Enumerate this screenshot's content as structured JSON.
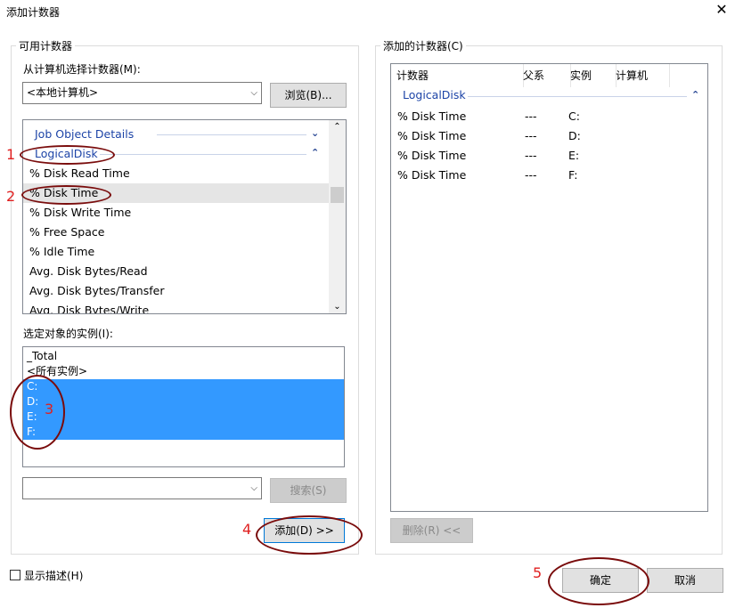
{
  "window": {
    "title": "添加计数器",
    "close_glyph": "✕"
  },
  "available": {
    "group_label": "可用计数器",
    "computer_label": "从计算机选择计数器(M):",
    "computer_value": "<本地计算机>",
    "browse_label": "浏览(B)...",
    "counters": [
      {
        "text": "Job Object Details",
        "kind": "category",
        "chevron": "⌄"
      },
      {
        "text": "LogicalDisk",
        "kind": "category",
        "chevron": "⌃"
      },
      {
        "text": "% Disk Read Time"
      },
      {
        "text": "% Disk Time",
        "selected": true
      },
      {
        "text": "% Disk Write Time"
      },
      {
        "text": "% Free Space"
      },
      {
        "text": "% Idle Time"
      },
      {
        "text": "Avg. Disk Bytes/Read"
      },
      {
        "text": "Avg. Disk Bytes/Transfer"
      },
      {
        "text": "Avg. Disk Bytes/Write"
      }
    ],
    "instances_label": "选定对象的实例(I):",
    "instances": [
      {
        "text": "_Total"
      },
      {
        "text": "<所有实例>"
      },
      {
        "text": "C:",
        "selected": true
      },
      {
        "text": "D:",
        "selected": true
      },
      {
        "text": "E:",
        "selected": true
      },
      {
        "text": "F:",
        "selected": true
      }
    ],
    "search_value": "",
    "search_label": "搜索(S)",
    "add_label": "添加(D) >>"
  },
  "added": {
    "group_label": "添加的计数器(C)",
    "columns": [
      "计数器",
      "父系",
      "实例",
      "计算机"
    ],
    "category": "LogicalDisk",
    "rows": [
      {
        "counter": "% Disk Time",
        "parent": "---",
        "instance": "C:",
        "computer": ""
      },
      {
        "counter": "% Disk Time",
        "parent": "---",
        "instance": "D:",
        "computer": ""
      },
      {
        "counter": "% Disk Time",
        "parent": "---",
        "instance": "E:",
        "computer": ""
      },
      {
        "counter": "% Disk Time",
        "parent": "---",
        "instance": "F:",
        "computer": ""
      }
    ],
    "remove_label": "删除(R) <<"
  },
  "footer": {
    "show_description_label": "显示描述(H)",
    "ok_label": "确定",
    "cancel_label": "取消"
  },
  "annotations": [
    "1",
    "2",
    "3",
    "4",
    "5"
  ],
  "colors": {
    "selection": "#3399ff",
    "annotation_text": "#e02020",
    "annotation_circle": "#7a0c0c",
    "category_text": "#1d44a7"
  }
}
